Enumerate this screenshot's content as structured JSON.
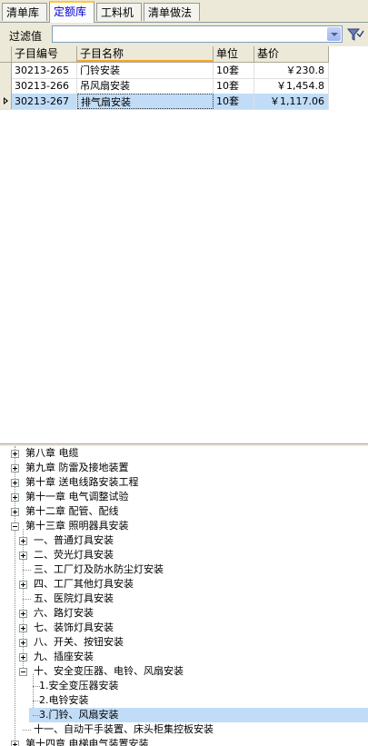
{
  "tabs": [
    "清单库",
    "定额库",
    "工料机",
    "清单做法"
  ],
  "filter": {
    "label": "过滤值",
    "value": ""
  },
  "grid": {
    "columns": [
      "子目编号",
      "子目名称",
      "单位",
      "基价"
    ],
    "rows": [
      {
        "code": "30213-265",
        "name": "门铃安装",
        "unit": "10套",
        "price": "￥230.8"
      },
      {
        "code": "30213-266",
        "name": "吊风扇安装",
        "unit": "10套",
        "price": "￥1,454.8"
      },
      {
        "code": "30213-267",
        "name": "排气扇安装",
        "unit": "10套",
        "price": "￥1,117.06"
      }
    ]
  },
  "tree": [
    {
      "label": "第八章  电缆",
      "state": "collapsed"
    },
    {
      "label": "第九章  防雷及接地装置",
      "state": "collapsed"
    },
    {
      "label": "第十章  送电线路安装工程",
      "state": "collapsed"
    },
    {
      "label": "第十一章  电气调整试验",
      "state": "collapsed"
    },
    {
      "label": "第十二章  配管、配线",
      "state": "collapsed"
    },
    {
      "label": "第十三章  照明器具安装",
      "state": "expanded"
    },
    {
      "label": "一、普通灯具安装",
      "state": "collapsed"
    },
    {
      "label": "二、荧光灯具安装",
      "state": "collapsed"
    },
    {
      "label": "三、工厂灯及防水防尘灯安装",
      "state": "leaf"
    },
    {
      "label": "四、工厂其他灯具安装",
      "state": "collapsed"
    },
    {
      "label": "五、医院灯具安装",
      "state": "leaf"
    },
    {
      "label": "六、路灯安装",
      "state": "collapsed"
    },
    {
      "label": "七、装饰灯具安装",
      "state": "collapsed"
    },
    {
      "label": "八、开关、按钮安装",
      "state": "collapsed"
    },
    {
      "label": "九、插座安装",
      "state": "collapsed"
    },
    {
      "label": "十、安全变压器、电铃、风扇安装",
      "state": "expanded"
    },
    {
      "label": "1.安全变压器安装",
      "state": "leaf"
    },
    {
      "label": "2.电铃安装",
      "state": "leaf"
    },
    {
      "label": "3.门铃、风扇安装",
      "state": "leaf",
      "selected": true
    },
    {
      "label": "十一、自动干手装置、床头柜集控板安装",
      "state": "leaf"
    },
    {
      "label": "第十四章  电梯电气装置安装",
      "state": "collapsed"
    }
  ]
}
